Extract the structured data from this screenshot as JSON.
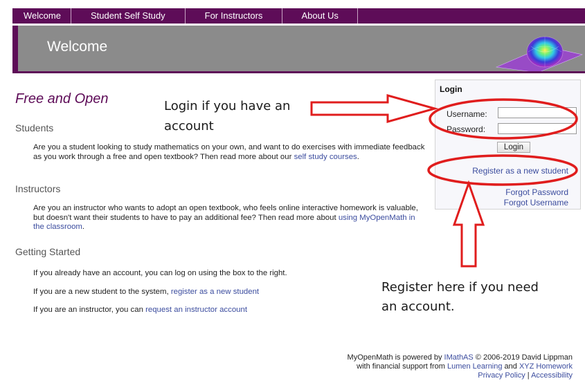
{
  "nav": {
    "items": [
      {
        "label": "Welcome"
      },
      {
        "label": "Student Self Study"
      },
      {
        "label": "For Instructors"
      },
      {
        "label": "About Us"
      }
    ]
  },
  "banner": {
    "title": "Welcome"
  },
  "main": {
    "hero_title": "Free and Open",
    "students_heading": "Students",
    "students_text": "Are you a student looking to study mathematics on your own, and want to do exercises with immediate feedback as you work through a free and open textbook? Then read more about our ",
    "students_link": "self study courses",
    "instructors_heading": "Instructors",
    "instructors_text": "Are you an instructor who wants to adopt an open textbook, who feels online interactive homework is valuable, but doesn't want their students to have to pay an additional fee? Then read more about ",
    "instructors_link": "using MyOpenMath in the classroom",
    "getting_started_heading": "Getting Started",
    "gs_line1": "If you already have an account, you can log on using the box to the right.",
    "gs_line2_text": "If you are a new student to the system, ",
    "gs_line2_link": "register as a new student",
    "gs_line3_text": "If you are an instructor, you can ",
    "gs_line3_link": "request an instructor account",
    "period": "."
  },
  "login": {
    "title": "Login",
    "username_label": "Username:",
    "password_label": "Password:",
    "username_value": "",
    "password_value": "",
    "button_label": "Login",
    "register_link": "Register as a new student",
    "forgot_password": "Forgot Password",
    "forgot_username": "Forgot Username"
  },
  "annotations": {
    "login_note_line1": "Login if you have an",
    "login_note_line2": "account",
    "register_note_line1": "Register here if you need",
    "register_note_line2": "an account.",
    "annotation_color": "#e01d1d"
  },
  "footer": {
    "line1_prefix": "MyOpenMath is powered by ",
    "imathas": "IMathAS",
    "line1_suffix": " © 2006-2019 David Lippman",
    "line2_prefix": "with financial support from ",
    "lumen": "Lumen Learning",
    "line2_mid": " and ",
    "xyz": "XYZ Homework",
    "privacy": "Privacy Policy",
    "separator": " | ",
    "accessibility": "Accessibility"
  },
  "colors": {
    "brand": "#5e0c58",
    "banner": "#8b8b8b",
    "link": "#3b4c9e"
  }
}
